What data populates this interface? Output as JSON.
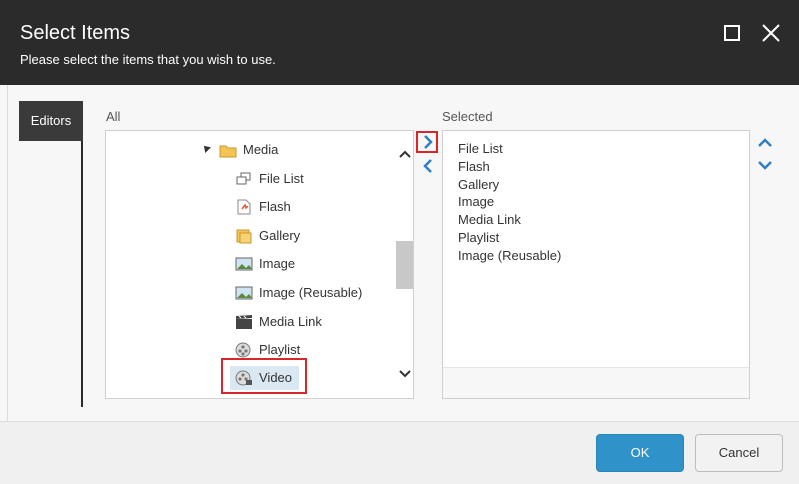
{
  "dialog": {
    "title": "Select Items",
    "subtitle": "Please select the items that you wish to use."
  },
  "sidebar": {
    "tabs": [
      {
        "label": "Editors",
        "active": true
      }
    ]
  },
  "all": {
    "label": "All",
    "tree": {
      "parent": {
        "label": "Media",
        "icon": "folder-icon",
        "expanded": true
      },
      "children": [
        {
          "label": "File List",
          "icon": "file-list-icon"
        },
        {
          "label": "Flash",
          "icon": "flash-icon"
        },
        {
          "label": "Gallery",
          "icon": "gallery-icon"
        },
        {
          "label": "Image",
          "icon": "image-icon"
        },
        {
          "label": "Image (Reusable)",
          "icon": "image-icon"
        },
        {
          "label": "Media Link",
          "icon": "media-link-icon"
        },
        {
          "label": "Playlist",
          "icon": "playlist-icon"
        },
        {
          "label": "Video",
          "icon": "video-icon",
          "selected": true
        }
      ]
    }
  },
  "selected": {
    "label": "Selected",
    "items": [
      "File List",
      "Flash",
      "Gallery",
      "Image",
      "Media Link",
      "Playlist",
      "Image (Reusable)"
    ]
  },
  "footer": {
    "ok_label": "OK",
    "cancel_label": "Cancel"
  },
  "colors": {
    "header_bg": "#2b2b2b",
    "accent": "#2f93c9",
    "highlight": "#d9262b",
    "selected_row": "#d9e8f3"
  }
}
